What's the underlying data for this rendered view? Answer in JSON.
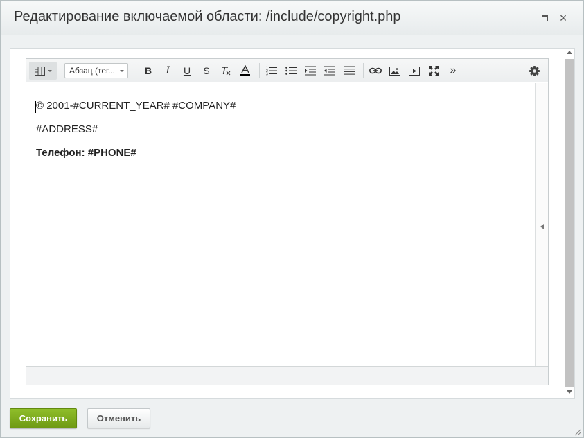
{
  "window": {
    "title": "Редактирование включаемой области: /include/copyright.php"
  },
  "toolbar": {
    "format_select": "Абзац (тег...",
    "bold": "B",
    "italic": "I",
    "underline": "U",
    "strike": "S",
    "more": "»"
  },
  "document": {
    "line1": "© 2001-#CURRENT_YEAR# #COMPANY#",
    "line2": "#ADDRESS#",
    "line3": "Телефон: #PHONE#"
  },
  "footer": {
    "save_label": "Сохранить",
    "cancel_label": "Отменить"
  },
  "icons": [
    "view-mode-icon",
    "remove-format-icon",
    "text-color-icon",
    "ordered-list-icon",
    "unordered-list-icon",
    "indent-icon",
    "outdent-icon",
    "justify-icon",
    "link-icon",
    "image-icon",
    "video-icon",
    "fullscreen-icon",
    "settings-icon"
  ],
  "colors": {
    "save_button": "#7aa81d",
    "text_color_bar": "#000000",
    "scrollbar_track": "#c2c2c2"
  }
}
